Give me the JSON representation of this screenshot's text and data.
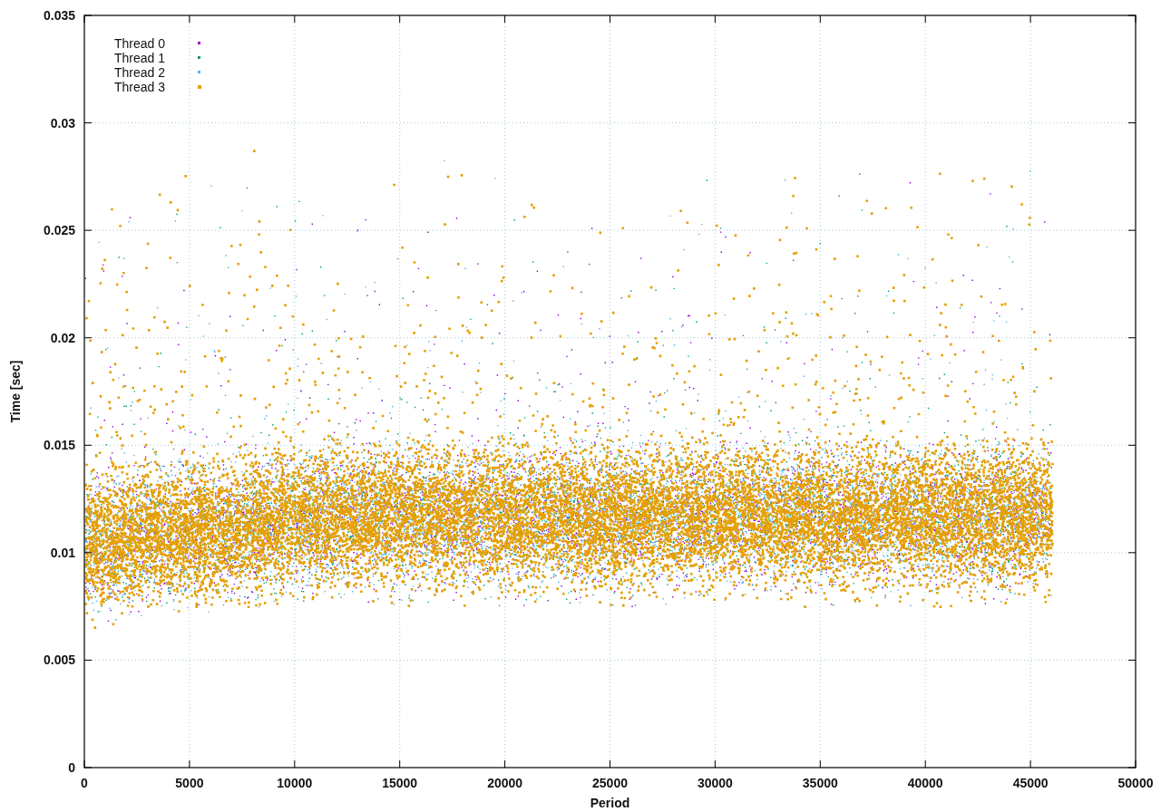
{
  "plot": {
    "x_axis_title": "Period",
    "y_axis_title": "Time [sec]",
    "x_tick_labels": [
      "0",
      "5000",
      "10000",
      "15000",
      "20000",
      "25000",
      "30000",
      "35000",
      "40000",
      "45000",
      "50000"
    ],
    "y_tick_labels": [
      "0.035",
      "0.03",
      "0.025",
      "0.02",
      "0.015",
      "0.01",
      "0.005",
      "0"
    ],
    "legend": [
      {
        "label": "Thread 0",
        "color": "#9400d3"
      },
      {
        "label": "Thread 1",
        "color": "#009e73"
      },
      {
        "label": "Thread 2",
        "color": "#56b4e9"
      },
      {
        "label": "Thread 3",
        "color": "#e69f00"
      }
    ]
  }
}
